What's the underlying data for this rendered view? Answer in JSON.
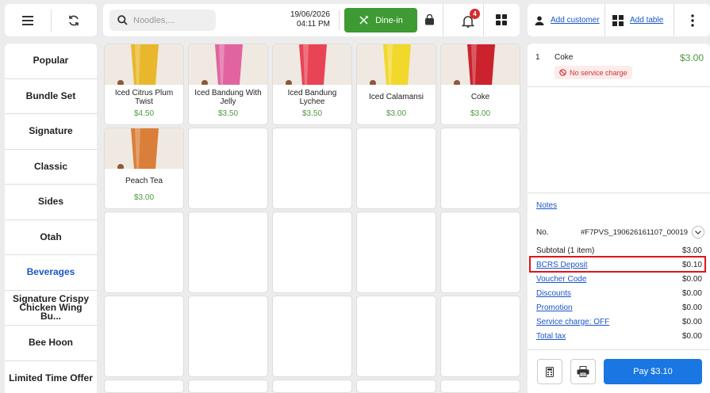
{
  "header": {
    "search_placeholder": "Noodles,...",
    "date": "19/06/2026",
    "time": "04:11 PM",
    "dine_in_label": "Dine-in",
    "notification_count": "4",
    "add_customer": "Add customer",
    "add_table": "Add table"
  },
  "categories": [
    {
      "label": "Popular"
    },
    {
      "label": "Bundle Set"
    },
    {
      "label": "Signature"
    },
    {
      "label": "Classic"
    },
    {
      "label": "Sides"
    },
    {
      "label": "Otah"
    },
    {
      "label": "Beverages",
      "active": true
    },
    {
      "label": "Signature Crispy Chicken Wing Bu..."
    },
    {
      "label": "Bee Hoon"
    },
    {
      "label": "Limited Time Offer"
    }
  ],
  "products": [
    {
      "name": "Iced Citrus Plum Twist",
      "price": "$4.50",
      "color": "#e8b21c"
    },
    {
      "name": "Iced Bandung With Jelly",
      "price": "$3.50",
      "color": "#e0589a"
    },
    {
      "name": "Iced Bandung Lychee",
      "price": "$3.50",
      "color": "#e8344a"
    },
    {
      "name": "Iced Calamansi",
      "price": "$3.00",
      "color": "#f2d61a"
    },
    {
      "name": "Coke",
      "price": "$3.00",
      "color": "#c8101e"
    },
    {
      "name": "Peach Tea",
      "price": "$3.00",
      "color": "#d8752a"
    }
  ],
  "order": {
    "items": [
      {
        "qty": "1",
        "name": "Coke",
        "price": "$3.00",
        "tag": "No service charge"
      }
    ],
    "notes_label": "Notes",
    "order_no_label": "No.",
    "order_no": "#F7PVS_190626161107_00019",
    "summary": [
      {
        "label": "Subtotal (1 item)",
        "value": "$3.00",
        "link": false
      },
      {
        "label": "BCRS Deposit",
        "value": "$0.10",
        "link": true
      },
      {
        "label": "Voucher Code",
        "value": "$0.00",
        "link": true
      },
      {
        "label": "Discounts",
        "value": "$0.00",
        "link": true
      },
      {
        "label": "Promotion",
        "value": "$0.00",
        "link": true
      },
      {
        "label": "Service charge: OFF",
        "value": "$0.00",
        "link": true
      },
      {
        "label": "Total tax",
        "value": "$0.00",
        "link": true
      }
    ],
    "pay_label": "Pay $3.10"
  },
  "colors": {
    "accent": "#1976e2",
    "green": "#3e9a32",
    "highlight": "#e0141a"
  }
}
